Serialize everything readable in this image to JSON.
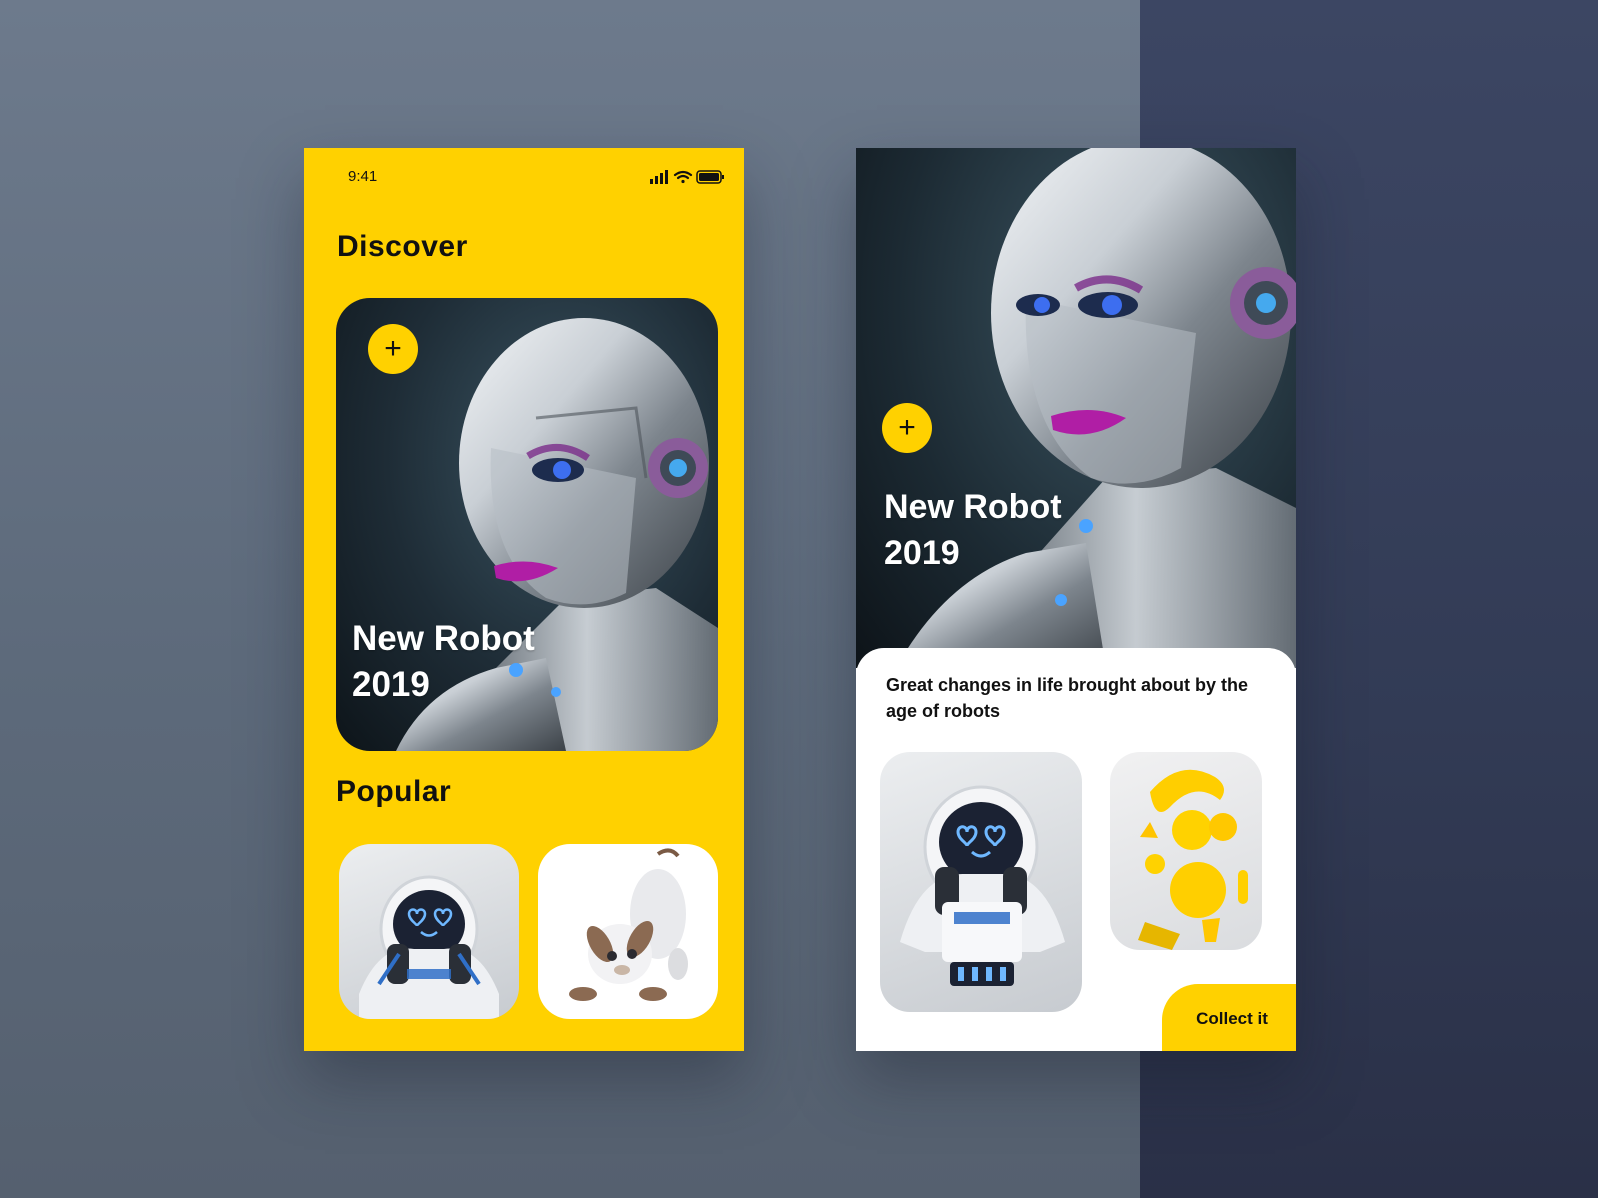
{
  "status_bar": {
    "time": "9:41"
  },
  "discover": {
    "title": "Discover",
    "hero": {
      "add_symbol": "+",
      "title_line1": "New Robot",
      "title_line2": "2019"
    }
  },
  "popular": {
    "title": "Popular"
  },
  "detail": {
    "hero": {
      "add_symbol": "+",
      "title_line1": "New Robot",
      "title_line2": "2019"
    },
    "description": "Great changes in life brought about by the age of robots",
    "collect_label": "Collect  it"
  },
  "colors": {
    "accent": "#ffd100",
    "background": "#5f6b7d",
    "dark_panel": "#323b55"
  }
}
